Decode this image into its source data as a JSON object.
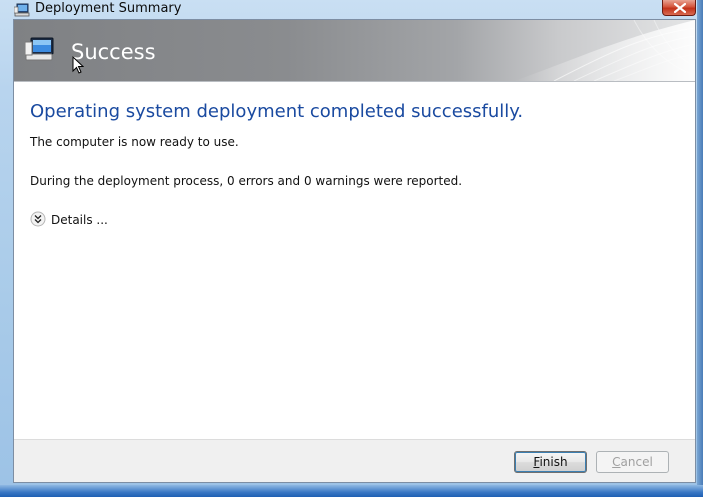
{
  "window": {
    "title": "Deployment Summary"
  },
  "banner": {
    "title": "Success"
  },
  "content": {
    "heading": "Operating system deployment completed successfully.",
    "ready_text": "The computer is now ready to use.",
    "report_text": "During the deployment process, 0 errors and 0 warnings were reported.",
    "details_label": "Details ..."
  },
  "footer": {
    "finish_first": "F",
    "finish_rest": "inish",
    "cancel_first": "C",
    "cancel_rest": "ancel"
  },
  "colors": {
    "heading": "#1a4aa0",
    "banner_gray": "#8a8c8f",
    "close_red": "#c2321a"
  },
  "icons": [
    "computer-icon",
    "monitor-icon",
    "cursor-icon",
    "chevron-down-icon",
    "close-icon"
  ]
}
